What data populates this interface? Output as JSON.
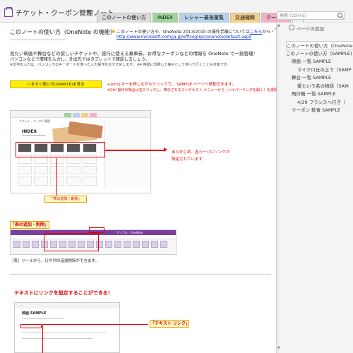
{
  "header": {
    "notebook_title": "チケット・クーポン管理ノート",
    "dropdown_caret": "▼",
    "tabs": [
      {
        "label": "このノートの使い方",
        "bg": "#dcdcdc"
      },
      {
        "label": "INDEX",
        "bg": "#9fd59a"
      },
      {
        "label": "レシャー最後履覧",
        "bg": "#b7d2ea"
      },
      {
        "label": "交通機関",
        "bg": "#f6cf8c"
      },
      {
        "label": "クーポン",
        "bg": "#f2b2c6"
      },
      {
        "label": "+",
        "bg": "#eeeeee"
      }
    ],
    "search_placeholder": "検索 (Ctrl+E)"
  },
  "page": {
    "title": "このノートの使い方（OneNote の機能）",
    "note_line1": "このノートの使い方や、OneNote 2013/2010 の操作手順については",
    "note_link": "こちら",
    "note_line1_tail": "から",
    "note_line2": "http://www.microsoft.com/ja-jp/office/pipc/onenote/default.aspx",
    "intro1": "見たい映画や舞台などの欲しいチケットや、旅行に使える乗車券、お得なクーポンなどの情報を OneNote で一括管理！",
    "intro2": "パソコンなどで情報を入力し、外出先ではタブレットで確認しましょう。",
    "intro3": "※文字の入力は、パソコンでのキーボードを使った入力操作をおすすめします。 A4 用紙に印刷して冊子として持って行くことも可能です。",
    "sample_button": "いますぐ使い方(SAMPLE)を見る",
    "tip1": "←[ctrl] キーを押しながらクリックで、 SAMPLE ページへ移動できます。",
    "tip2": "※Ctrl 操作の場合は右クリックし、表示されるコンテキスト メニューから［ハイパーリンクを開く］を選択",
    "shot1_title": "チケット・クーポン管理",
    "shot1_index": "INDEX",
    "annotation_line1": "あらかじめ、各ページにリンクが",
    "annotation_line2": "設定されています",
    "label_table_small": "「表の追加・削除」",
    "label_table": "「表の追加・削除」",
    "shot2_title": "サンプル - OneNote",
    "caption_table": "［表］ツールから、行や列の追加削除ができます。",
    "link_heading": "テキストにリンクを設定することができる！",
    "shot3_title": "映画 SAMPLE",
    "label_link": "「テキスト リンク」"
  },
  "icons": {
    "expand": "⤢",
    "scroll_up": "▲",
    "scroll_down": "▼",
    "star": "★"
  },
  "pane": {
    "add_page": "ページの追加",
    "items": [
      {
        "label": "このノートの使い方（OneNote",
        "indent": 0,
        "active": true
      },
      {
        "label": "このノートの使い方（SAMPLE)",
        "indent": 0,
        "active": false
      },
      {
        "label": "映画 一覧 SAMPLE",
        "indent": 1,
        "active": false
      },
      {
        "label": "マイクロ丘の上で（SAMP",
        "indent": 2,
        "active": false
      },
      {
        "label": "舞台 一覧 SAMPLE",
        "indent": 1,
        "active": false
      },
      {
        "label": "愛という名の物語（SAM",
        "indent": 2,
        "active": false
      },
      {
        "label": "飛行機 一覧 SAMPLE",
        "indent": 1,
        "active": false
      },
      {
        "label": "4/29 フランスへ行き（",
        "indent": 2,
        "active": false
      },
      {
        "label": "クーポン 飲食 SAMPLE",
        "indent": 1,
        "active": false
      }
    ]
  }
}
